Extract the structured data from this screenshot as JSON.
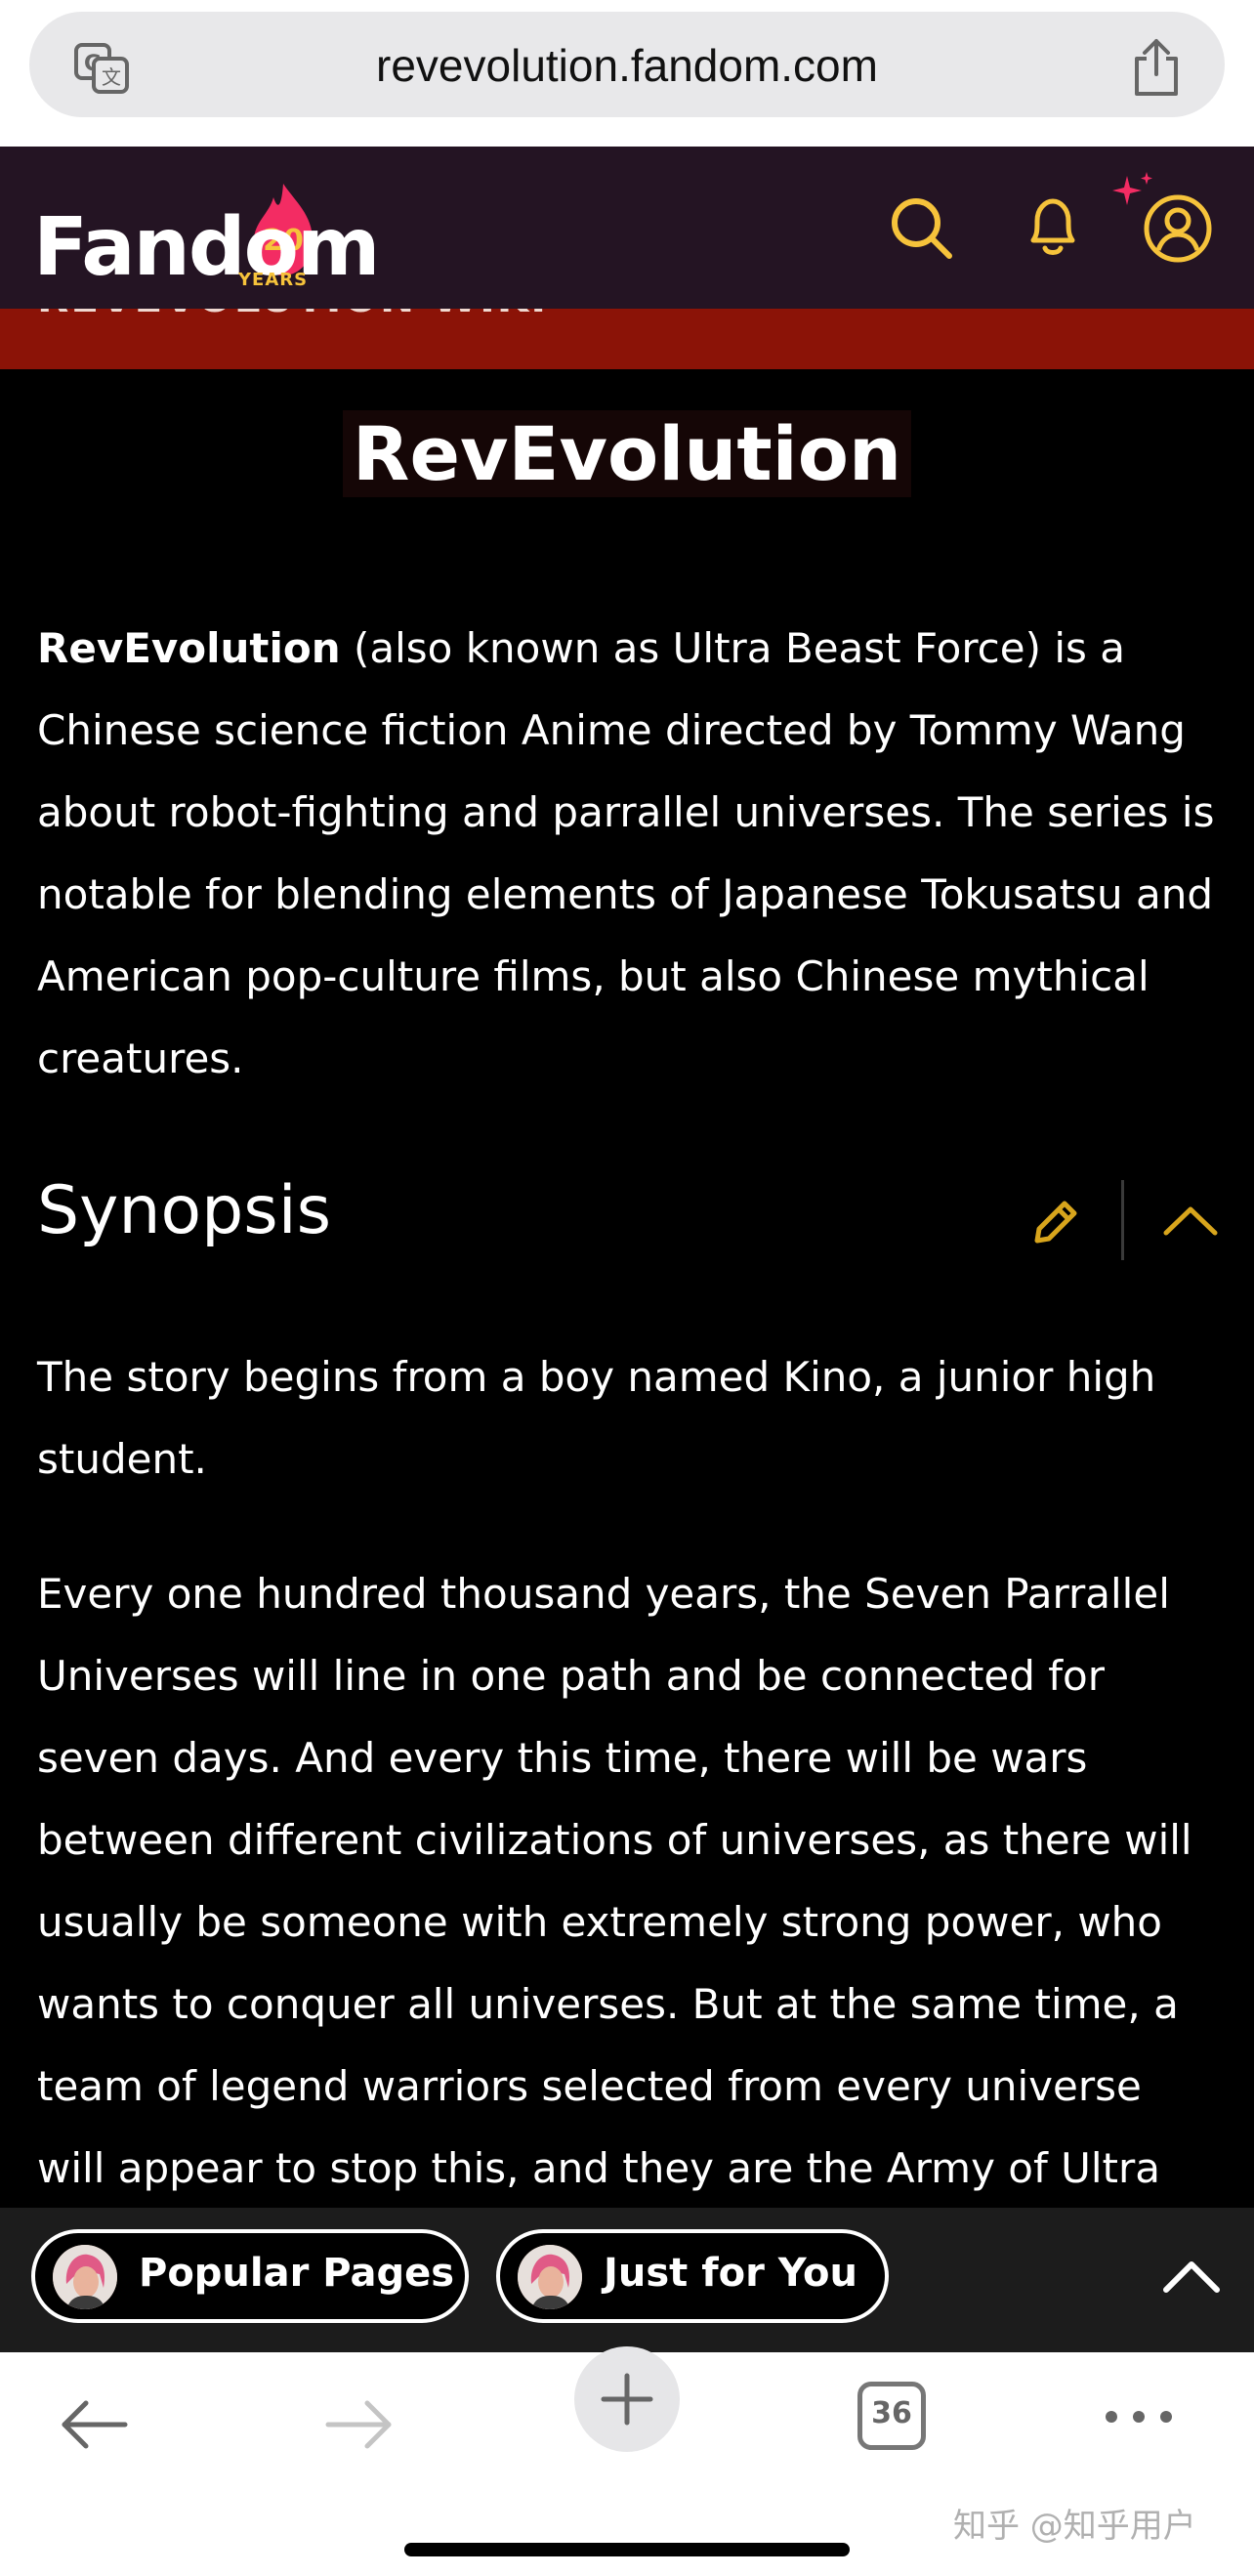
{
  "browser": {
    "url": "revevolution.fandom.com",
    "tab_count": "36"
  },
  "header": {
    "logo_text": "Fandom",
    "logo_badge": "20",
    "logo_years": "YEARS"
  },
  "wiki_bar": {
    "title": "REVEVOLUTION WIKI"
  },
  "article": {
    "title": "RevEvolution",
    "intro_bold": "RevEvolution",
    "intro_rest": " (also known as Ultra Beast Force) is a Chinese science fiction Anime directed by Tommy Wang about robot-fighting and parrallel universes. The series is notable for blending elements of Japanese Tokusatsu and American pop-culture films, but also Chinese mythical creatures.",
    "section_title": "Synopsis",
    "synopsis_p1": "The story begins from a boy named Kino, a junior high student.",
    "synopsis_p2": "Every one hundred thousand years, the Seven Parrallel Universes will line in one path and be connected for seven days. And every this time, there will be wars between different civilizations of universes, as there will usually be someone with extremely strong power, who wants to conquer all universes. But at the same time, a team of legend warriors selected from every universe will appear to stop this, and they are the Army of Ultra"
  },
  "recommendations": {
    "popular_label": "Popular Pages",
    "foryou_label": "Just for You"
  },
  "watermark": "知乎 @知乎用户",
  "colors": {
    "fandom_header": "#241423",
    "wiki_bar": "#8b1307",
    "accent_yellow": "#f6c33b",
    "icon_gold": "#d8a51c"
  }
}
